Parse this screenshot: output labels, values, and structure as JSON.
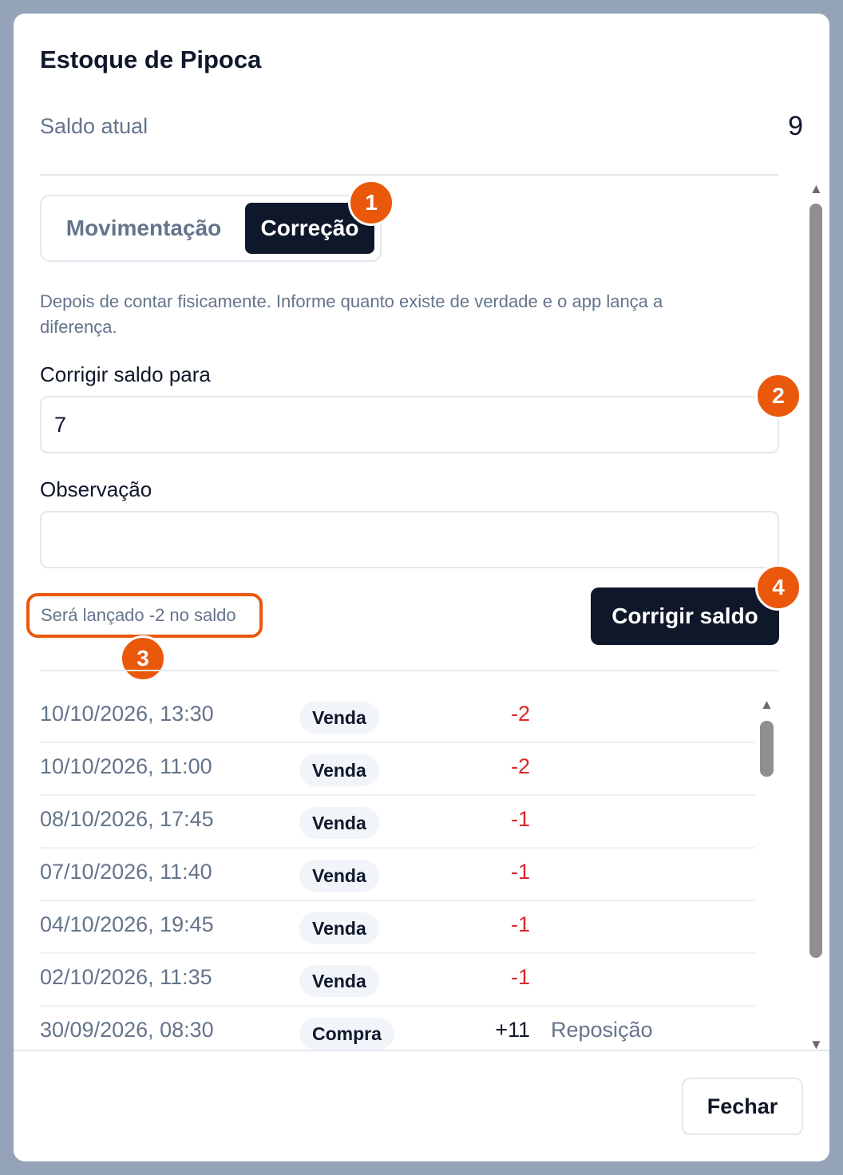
{
  "modal": {
    "title": "Estoque de Pipoca",
    "balance_label": "Saldo atual",
    "balance_value": "9"
  },
  "tabs": [
    {
      "label": "Movimentação",
      "active": false
    },
    {
      "label": "Correção",
      "active": true
    }
  ],
  "correction": {
    "hint": "Depois de contar fisicamente. Informe quanto existe de verdade e o app lança a diferença.",
    "target_label": "Corrigir saldo para",
    "target_value": "7",
    "note_label": "Observação",
    "note_value": "",
    "preview_text": "Será lançado -2 no saldo",
    "submit_label": "Corrigir saldo"
  },
  "badges": [
    "1",
    "2",
    "3",
    "4"
  ],
  "history": [
    {
      "date": "10/10/2026, 13:30",
      "type": "Venda",
      "qty": "-2",
      "note": ""
    },
    {
      "date": "10/10/2026, 11:00",
      "type": "Venda",
      "qty": "-2",
      "note": ""
    },
    {
      "date": "08/10/2026, 17:45",
      "type": "Venda",
      "qty": "-1",
      "note": ""
    },
    {
      "date": "07/10/2026, 11:40",
      "type": "Venda",
      "qty": "-1",
      "note": ""
    },
    {
      "date": "04/10/2026, 19:45",
      "type": "Venda",
      "qty": "-1",
      "note": ""
    },
    {
      "date": "02/10/2026, 11:35",
      "type": "Venda",
      "qty": "-1",
      "note": ""
    },
    {
      "date": "30/09/2026, 08:30",
      "type": "Compra",
      "qty": "+11",
      "note": "Reposição"
    }
  ],
  "footer": {
    "close_label": "Fechar"
  },
  "colors": {
    "accent": "#ea580c",
    "primary": "#0f172a",
    "negative": "#dc2626",
    "muted": "#64748b",
    "backdrop": "#94a3b8"
  },
  "icons": {
    "scroll_up": "triangle-up-icon",
    "scroll_down": "triangle-down-icon"
  }
}
